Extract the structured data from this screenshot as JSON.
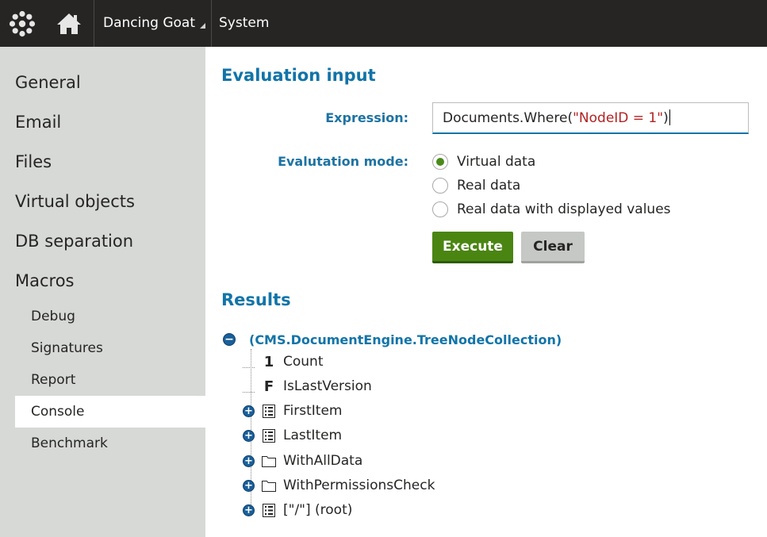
{
  "header": {
    "logo_icon": "kentico-flower-icon",
    "home_icon": "home-icon",
    "site_name": "Dancing Goat",
    "app_name": "System"
  },
  "sidebar": {
    "main_items": [
      "General",
      "Email",
      "Files",
      "Virtual objects",
      "DB separation",
      "Macros"
    ],
    "sub_items": [
      "Debug",
      "Signatures",
      "Report",
      "Console",
      "Benchmark"
    ],
    "selected": "Console"
  },
  "evaluation": {
    "heading": "Evaluation input",
    "expression_label": "Expression:",
    "expression_prefix": "Documents.Where(",
    "expression_string": "\"NodeID = 1\"",
    "expression_suffix": ")",
    "mode_label": "Evalutation mode:",
    "modes": [
      "Virtual data",
      "Real data",
      "Real data with displayed values"
    ],
    "selected_mode": "Virtual data",
    "execute_label": "Execute",
    "clear_label": "Clear"
  },
  "results": {
    "heading": "Results",
    "root_label": "(CMS.DocumentEngine.TreeNodeCollection)",
    "items": [
      {
        "label": "Count",
        "icon": "1",
        "expandable": false
      },
      {
        "label": "IsLastVersion",
        "icon": "F",
        "expandable": false
      },
      {
        "label": "FirstItem",
        "icon": "list-icon",
        "expandable": true
      },
      {
        "label": "LastItem",
        "icon": "list-icon",
        "expandable": true
      },
      {
        "label": "WithAllData",
        "icon": "folder-icon",
        "expandable": true
      },
      {
        "label": "WithPermissionsCheck",
        "icon": "folder-icon",
        "expandable": true
      },
      {
        "label": "[\"/\"] (root)",
        "icon": "list-icon",
        "expandable": true
      }
    ]
  },
  "colors": {
    "header_bg": "#262524",
    "sidebar_bg": "#d6d9d6",
    "heading_blue": "#1174a8",
    "execute_green": "#4a8512",
    "string_red": "#b22222"
  }
}
